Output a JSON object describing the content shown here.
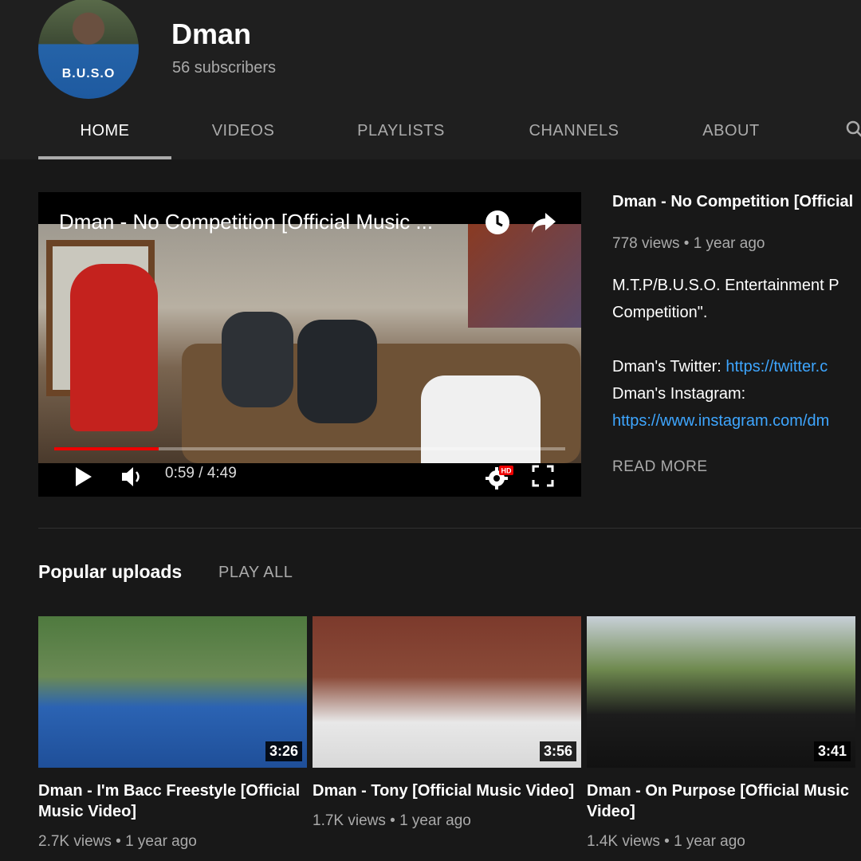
{
  "channel": {
    "name": "Dman",
    "subscribers": "56 subscribers",
    "avatar_shirt_text": "B.U.S.O"
  },
  "tabs": [
    {
      "label": "HOME",
      "active": true
    },
    {
      "label": "VIDEOS",
      "active": false
    },
    {
      "label": "PLAYLISTS",
      "active": false
    },
    {
      "label": "CHANNELS",
      "active": false
    },
    {
      "label": "ABOUT",
      "active": false
    }
  ],
  "icons": {
    "search": "search-icon",
    "watch_later": "clock-icon",
    "share": "share-icon",
    "play": "play-icon",
    "volume": "volume-icon",
    "settings": "gear-icon",
    "fullscreen": "fullscreen-icon"
  },
  "player": {
    "title": "Dman - No Competition [Official Music ...",
    "time": "0:59 / 4:49",
    "progress": 0.204,
    "quality_badge": "HD"
  },
  "featured": {
    "title": "Dman - No Competition [Official",
    "meta": "778 views • 1 year ago",
    "desc_line1": "M.T.P/B.U.S.O. Entertainment P",
    "desc_line2": "Competition\".",
    "twitter_label": "Dman's Twitter: ",
    "twitter_link": "https://twitter.c",
    "instagram_label": "Dman's Instagram:",
    "instagram_link": "https://www.instagram.com/dm",
    "read_more": "READ MORE"
  },
  "popular": {
    "title": "Popular uploads",
    "play_all": "PLAY ALL",
    "videos": [
      {
        "title": "Dman - I'm Bacc Freestyle [Official Music Video]",
        "duration": "3:26",
        "meta": "2.7K views • 1 year ago"
      },
      {
        "title": "Dman - Tony [Official Music Video]",
        "duration": "3:56",
        "meta": "1.7K views • 1 year ago"
      },
      {
        "title": "Dman - On Purpose [Official Music Video]",
        "duration": "3:41",
        "meta": "1.4K views • 1 year ago"
      }
    ]
  },
  "colors": {
    "background": "#181818",
    "header": "#1f1f1f",
    "link": "#3ea6ff",
    "progress": "#ee0000"
  }
}
